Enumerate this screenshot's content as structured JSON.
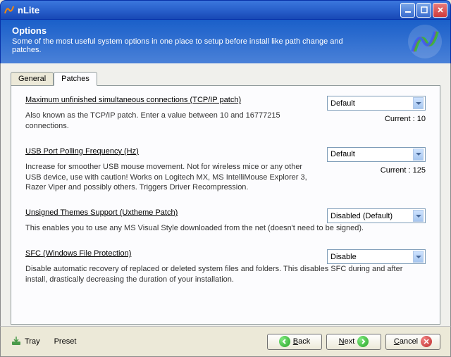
{
  "window": {
    "title": "nLite"
  },
  "header": {
    "title": "Options",
    "description": "Some of the most useful system options in one place to setup before install like path change and patches."
  },
  "tabs": {
    "general": "General",
    "patches": "Patches"
  },
  "sections": {
    "tcpip": {
      "title": "Maximum unfinished simultaneous connections (TCP/IP patch)",
      "desc": "Also known as the TCP/IP patch. Enter a value between 10 and 16777215 connections.",
      "value": "Default",
      "current": "Current : 10"
    },
    "usb": {
      "title": "USB Port Polling Frequency (Hz)",
      "desc": "Increase for smoother USB mouse movement. Not for wireless mice or any other USB device, use with caution! Works on Logitech MX, MS IntelliMouse Explorer 3, Razer Viper and possibly others. Triggers Driver Recompression.",
      "value": "Default",
      "current": "Current : 125"
    },
    "uxtheme": {
      "title": "Unsigned Themes Support (Uxtheme Patch)",
      "desc": "This enables you to use any MS Visual Style downloaded from the net (doesn't need to be signed).",
      "value": "Disabled (Default)"
    },
    "sfc": {
      "title": "SFC (Windows File Protection)",
      "desc": "Disable automatic recovery of replaced or deleted system files and folders. This disables SFC during and after install, drastically decreasing the duration of your installation.",
      "value": "Disable"
    }
  },
  "footer": {
    "tray": "Tray",
    "preset": "Preset",
    "back": "Back",
    "next": "Next",
    "cancel": "Cancel"
  }
}
